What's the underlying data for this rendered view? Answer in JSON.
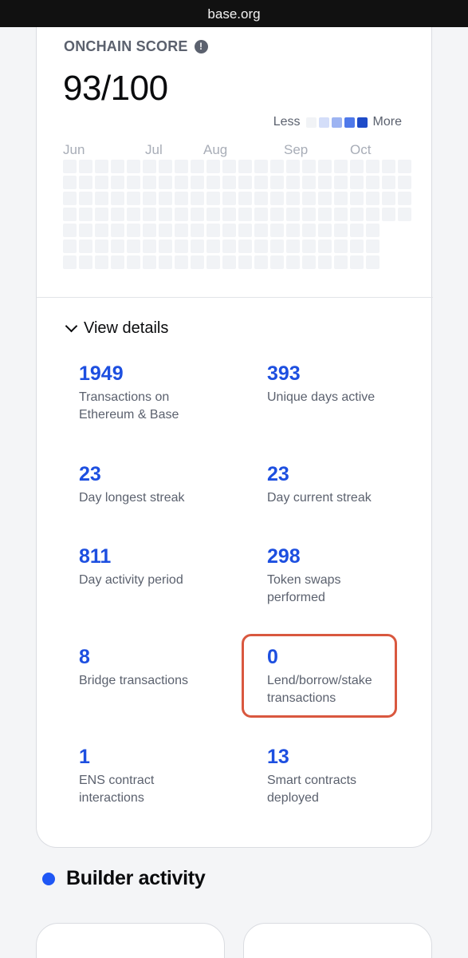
{
  "browser": {
    "url": "base.org"
  },
  "onchain_score": {
    "label": "ONCHAIN SCORE",
    "info_icon": "exclamation-icon",
    "value": "93/100",
    "legend": {
      "less": "Less",
      "more": "More",
      "colors": [
        "#f1f3f6",
        "#d4def9",
        "#9db4f2",
        "#4f79ea",
        "#1e4bc8"
      ]
    },
    "months": [
      "Jun",
      "Jul",
      "Aug",
      "Sep",
      "Oct"
    ],
    "heatmap_color": "#f1f3f6"
  },
  "details": {
    "toggle_label": "View details",
    "stats": [
      {
        "value": "1949",
        "label": "Transactions on Ethereum & Base"
      },
      {
        "value": "393",
        "label": "Unique days active"
      },
      {
        "value": "23",
        "label": "Day longest streak"
      },
      {
        "value": "23",
        "label": "Day current streak"
      },
      {
        "value": "811",
        "label": "Day activity period"
      },
      {
        "value": "298",
        "label": "Token swaps performed"
      },
      {
        "value": "8",
        "label": "Bridge transactions"
      },
      {
        "value": "0",
        "label": "Lend/borrow/stake transactions"
      },
      {
        "value": "1",
        "label": "ENS contract interactions"
      },
      {
        "value": "13",
        "label": "Smart contracts deployed"
      }
    ]
  },
  "builder_activity": {
    "title": "Builder activity",
    "accent": "#1f57f5"
  },
  "colors": {
    "stat_number": "#1d4fe0",
    "highlight": "#d9583f"
  }
}
